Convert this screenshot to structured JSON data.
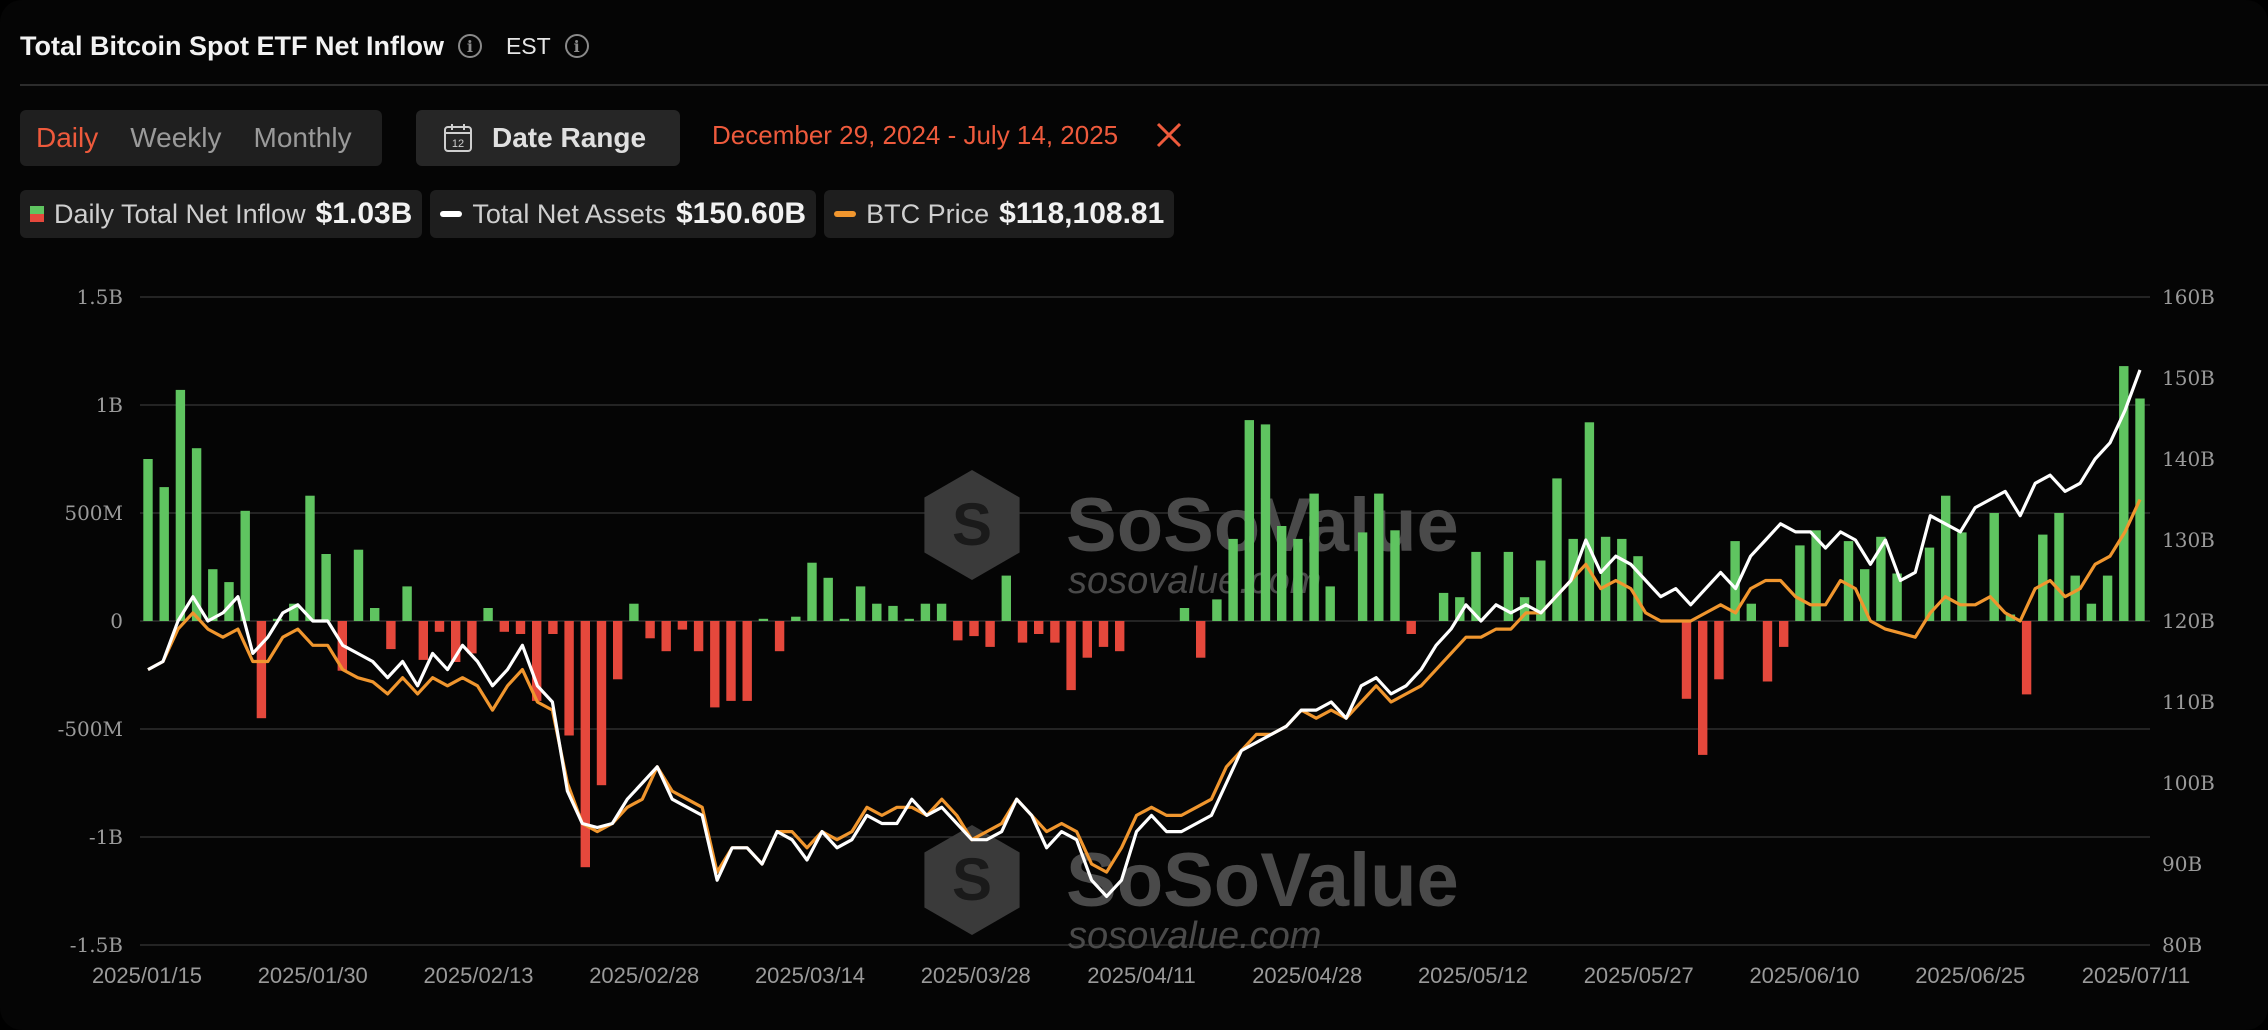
{
  "header": {
    "title": "Total Bitcoin Spot ETF Net Inflow",
    "timezone": "EST"
  },
  "controls": {
    "periods": [
      "Daily",
      "Weekly",
      "Monthly"
    ],
    "active_period": "Daily",
    "date_range_button": "Date Range",
    "date_range_icon_day": "12",
    "date_range_value": "December 29, 2024 - July 14, 2025"
  },
  "legend": [
    {
      "label": "Daily Total Net Inflow",
      "value": "$1.03B",
      "swatch": "bar"
    },
    {
      "label": "Total Net Assets",
      "value": "$150.60B",
      "swatch": "line",
      "color": "#ffffff"
    },
    {
      "label": "BTC Price",
      "value": "$118,108.81",
      "swatch": "line",
      "color": "#f0962e"
    }
  ],
  "watermark": {
    "name": "SoSoValue",
    "url": "sosovalue.com"
  },
  "colors": {
    "inflow": "#5fc460",
    "outflow": "#e5483c",
    "assets": "#ffffff",
    "price": "#f0962e",
    "accent": "#ee5a3c"
  },
  "chart_data": {
    "type": "bar",
    "title": "Total Bitcoin Spot ETF Net Inflow",
    "x_tick_labels": [
      "2025/01/15",
      "2025/01/30",
      "2025/02/13",
      "2025/02/28",
      "2025/03/14",
      "2025/03/28",
      "2025/04/11",
      "2025/04/28",
      "2025/05/12",
      "2025/05/27",
      "2025/06/10",
      "2025/06/25",
      "2025/07/11"
    ],
    "y_left": {
      "ticks": [
        -1.5,
        -1,
        -0.5,
        0,
        0.5,
        1,
        1.5
      ],
      "tick_labels": [
        "-1.5B",
        "-1B",
        "-500M",
        "0",
        "500M",
        "1B",
        "1.5B"
      ],
      "range": [
        -1.5,
        1.5
      ],
      "unit": "B USD"
    },
    "y_right": {
      "ticks": [
        80,
        90,
        100,
        110,
        120,
        130,
        140,
        150,
        160
      ],
      "tick_labels": [
        "80B",
        "90B",
        "100B",
        "110B",
        "120B",
        "130B",
        "140B",
        "150B",
        "160B"
      ],
      "range": [
        80,
        160
      ],
      "unit": "B USD"
    },
    "grid": true,
    "legend_position": "top-left",
    "series": [
      {
        "name": "Daily Total Net Inflow",
        "kind": "bar",
        "axis": "left",
        "values": [
          0.75,
          0.62,
          1.07,
          0.8,
          0.24,
          0.18,
          0.51,
          -0.45,
          0.01,
          0.08,
          0.58,
          0.31,
          -0.23,
          0.33,
          0.06,
          -0.13,
          0.16,
          -0.18,
          -0.05,
          -0.19,
          -0.15,
          0.06,
          -0.05,
          -0.06,
          -0.37,
          -0.06,
          -0.53,
          -1.14,
          -0.76,
          -0.27,
          0.08,
          -0.08,
          -0.14,
          -0.04,
          -0.14,
          -0.4,
          -0.37,
          -0.37,
          0.01,
          -0.14,
          0.02,
          0.27,
          0.2,
          0.01,
          0.16,
          0.08,
          0.07,
          0.01,
          0.08,
          0.08,
          -0.09,
          -0.07,
          -0.12,
          0.21,
          -0.1,
          -0.06,
          -0.1,
          -0.32,
          -0.17,
          -0.12,
          -0.14,
          0.0,
          0.0,
          0.0,
          0.06,
          -0.17,
          0.1,
          0.38,
          0.93,
          0.91,
          0.44,
          0.38,
          0.59,
          0.16,
          0.0,
          0.41,
          0.59,
          0.42,
          -0.06,
          0.0,
          0.13,
          0.11,
          0.32,
          0.0,
          0.32,
          0.11,
          0.28,
          0.66,
          0.38,
          0.92,
          0.39,
          0.38,
          0.3,
          0.0,
          0.0,
          -0.36,
          -0.62,
          -0.27,
          0.37,
          0.08,
          -0.28,
          -0.12,
          0.35,
          0.42,
          0.0,
          0.37,
          0.24,
          0.39,
          0.22,
          0.0,
          0.34,
          0.58,
          0.41,
          0.0,
          0.5,
          0.03,
          -0.34,
          0.4,
          0.5,
          0.21,
          0.08,
          0.21,
          1.18,
          1.03
        ]
      },
      {
        "name": "Total Net Assets",
        "kind": "line",
        "axis": "right",
        "values": [
          114,
          115,
          120,
          123,
          120,
          121,
          123,
          116,
          118,
          121,
          122,
          120,
          120,
          117,
          116,
          115,
          113,
          115,
          112,
          116,
          114,
          117,
          115,
          112,
          114,
          117,
          112,
          110,
          99,
          95,
          94.5,
          95,
          98,
          100,
          102,
          98,
          97,
          96,
          88,
          92,
          92,
          90,
          94,
          93,
          90.5,
          94,
          92,
          93,
          96,
          95,
          95,
          98,
          96,
          97,
          95,
          93,
          93,
          94,
          98,
          96,
          92,
          94,
          93,
          88,
          86,
          88,
          94,
          96,
          94,
          94,
          95,
          96,
          100,
          104,
          105,
          106,
          107,
          109,
          109,
          110,
          108,
          112,
          113,
          111,
          112,
          114,
          117,
          119,
          122,
          120,
          122,
          121,
          122,
          121,
          123,
          125,
          130,
          126,
          128,
          127,
          125,
          123,
          124,
          122,
          124,
          126,
          124,
          128,
          130,
          132,
          131,
          131,
          129,
          131,
          130,
          127,
          130,
          125,
          126,
          133,
          132,
          131,
          134,
          135,
          136,
          133,
          137,
          138,
          136,
          137,
          140,
          142,
          146,
          151
        ]
      },
      {
        "name": "BTC Price",
        "kind": "line",
        "axis": "right",
        "values": [
          114,
          115,
          119,
          121,
          119,
          118,
          119,
          115,
          115,
          118,
          119,
          117,
          117,
          114,
          113,
          112.5,
          111,
          113,
          111,
          113,
          112,
          113,
          112,
          109,
          112,
          114,
          110,
          109,
          100,
          95,
          94,
          95,
          97,
          98,
          102,
          99,
          98,
          97,
          89,
          92,
          92,
          90,
          94,
          94,
          92,
          94,
          93,
          94,
          97,
          96,
          97,
          97,
          96,
          98,
          96,
          93,
          94,
          95,
          98,
          96,
          94,
          95,
          94,
          90,
          89,
          92,
          96,
          97,
          96,
          96,
          97,
          98,
          102,
          104,
          106,
          106,
          107,
          109,
          108,
          109,
          108,
          110,
          112,
          110,
          111,
          112,
          114,
          116,
          118,
          118,
          119,
          119,
          121,
          121,
          123,
          125,
          127,
          124,
          125,
          124,
          121,
          120,
          120,
          120,
          121,
          122,
          121,
          124,
          125,
          125,
          123,
          122,
          122,
          125,
          124,
          120,
          119,
          118.5,
          118,
          121,
          123,
          122,
          122,
          123,
          121,
          120,
          124,
          125,
          123,
          124,
          127,
          128,
          131,
          135
        ]
      }
    ]
  }
}
